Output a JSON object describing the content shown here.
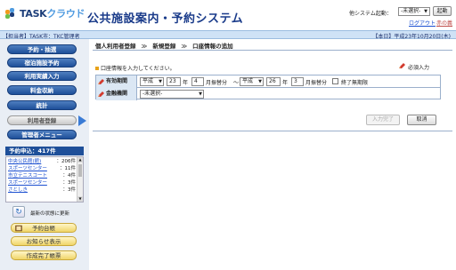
{
  "header": {
    "logo": {
      "part1": "TASK",
      "part2": "クラウド"
    },
    "app_title": "公共施設案内・予約システム",
    "other_system_label": "他システム起動：",
    "system_select": "-未選択-",
    "launch_button": "起動",
    "logout": "ログアウト",
    "user_link": "赤の義"
  },
  "infobar": {
    "left": "【担当者】TASK市：TKC管理者",
    "right": "【本日】平成23年10月20日(木)"
  },
  "sidebar": {
    "nav": [
      {
        "label": "予約・抽選",
        "active": false
      },
      {
        "label": "宿泊施設予約",
        "active": false
      },
      {
        "label": "利用実績入力",
        "active": false
      },
      {
        "label": "料金収納",
        "active": false
      },
      {
        "label": "統計",
        "active": false
      },
      {
        "label": "利用者登録",
        "active": true
      },
      {
        "label": "管理者メニュー",
        "active": false
      }
    ],
    "message_header": "予約申込：417件",
    "messages": [
      {
        "name": "中央公民館(館)",
        "count": "：206件"
      },
      {
        "name": "スポーツセンター",
        "count": "：11件"
      },
      {
        "name": "市立テニスコート",
        "count": "：4件"
      },
      {
        "name": "スポーツセンター",
        "count": "：3件"
      },
      {
        "name": "さとしき",
        "count": "：3件"
      }
    ],
    "refresh_text": "最新の状態に更新",
    "bottom_buttons": [
      "予約台帳",
      "お知らせ表示",
      "作成完了帳票"
    ]
  },
  "main": {
    "breadcrumb": [
      "個人利用者登録",
      "新規登録",
      "口座情報の追加"
    ],
    "instruction": "口座情報を入力してください。",
    "required_label": "必須入力",
    "form": {
      "validity_label": "有効期間",
      "era_from": "平成",
      "year_from": "23",
      "year_unit": "年",
      "month_from": "4",
      "month_suffix_from": "月振替分",
      "range_sep": "～",
      "era_to": "平成",
      "year_to": "26",
      "month_to": "3",
      "month_suffix_to": "月振替分",
      "no_end_label": "終了無期限",
      "bank_label": "金融機関",
      "bank_select": "-未選択-"
    },
    "buttons": {
      "done": "入力完了",
      "cancel": "取消"
    }
  },
  "colors": {
    "nav_blue": "#1e4f99",
    "accent_orange": "#e8a21a",
    "bar_blue": "#cfe2f6"
  }
}
